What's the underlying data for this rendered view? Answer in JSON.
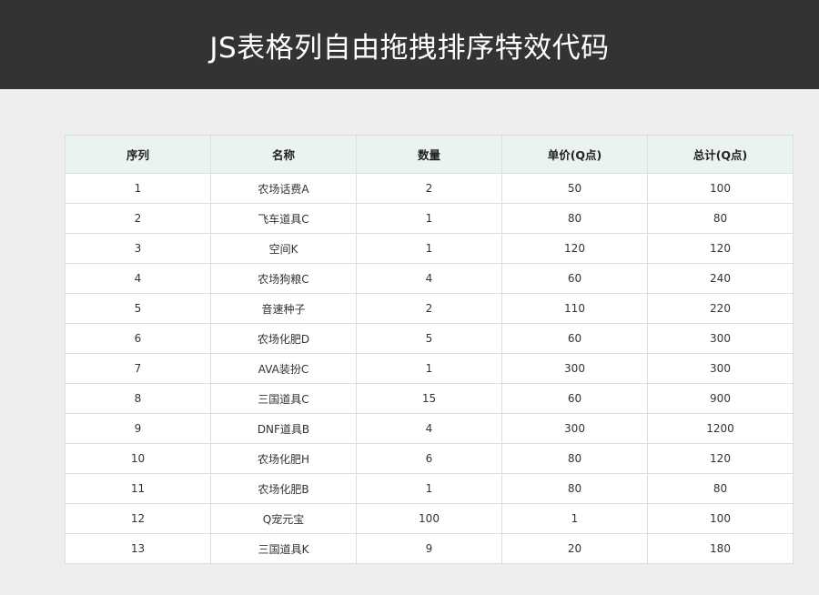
{
  "header": {
    "title": "JS表格列自由拖拽排序特效代码"
  },
  "table": {
    "columns": [
      "序列",
      "名称",
      "数量",
      "单价(Q点)",
      "总计(Q点)"
    ],
    "rows": [
      [
        "1",
        "农场话费A",
        "2",
        "50",
        "100"
      ],
      [
        "2",
        "飞车道具C",
        "1",
        "80",
        "80"
      ],
      [
        "3",
        "空间K",
        "1",
        "120",
        "120"
      ],
      [
        "4",
        "农场狗粮C",
        "4",
        "60",
        "240"
      ],
      [
        "5",
        "音速种子",
        "2",
        "110",
        "220"
      ],
      [
        "6",
        "农场化肥D",
        "5",
        "60",
        "300"
      ],
      [
        "7",
        "AVA装扮C",
        "1",
        "300",
        "300"
      ],
      [
        "8",
        "三国道具C",
        "15",
        "60",
        "900"
      ],
      [
        "9",
        "DNF道具B",
        "4",
        "300",
        "1200"
      ],
      [
        "10",
        "农场化肥H",
        "6",
        "80",
        "120"
      ],
      [
        "11",
        "农场化肥B",
        "1",
        "80",
        "80"
      ],
      [
        "12",
        "Q宠元宝",
        "100",
        "1",
        "100"
      ],
      [
        "13",
        "三国道具K",
        "9",
        "20",
        "180"
      ]
    ]
  }
}
